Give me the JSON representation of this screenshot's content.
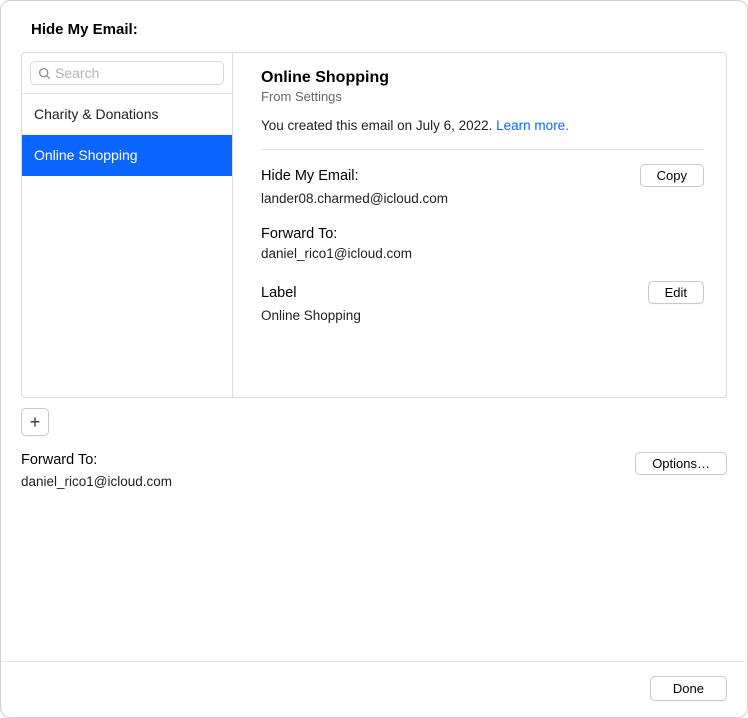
{
  "page_title": "Hide My Email:",
  "search": {
    "placeholder": "Search"
  },
  "sidebar": {
    "items": [
      {
        "label": "Charity & Donations",
        "selected": false
      },
      {
        "label": "Online Shopping",
        "selected": true
      }
    ]
  },
  "detail": {
    "title": "Online Shopping",
    "subtitle": "From Settings",
    "created_text": "You created this email on July 6, 2022. ",
    "learn_more": "Learn more.",
    "hide_label": "Hide My Email:",
    "hide_value": "lander08.charmed@icloud.com",
    "copy_label": "Copy",
    "forward_label": "Forward To:",
    "forward_value": "daniel_rico1@icloud.com",
    "label_label": "Label",
    "label_value": "Online Shopping",
    "edit_label": "Edit"
  },
  "add_button_glyph": "+",
  "forward_section": {
    "label": "Forward To:",
    "value": "daniel_rico1@icloud.com",
    "options_label": "Options…"
  },
  "footer": {
    "done_label": "Done"
  }
}
